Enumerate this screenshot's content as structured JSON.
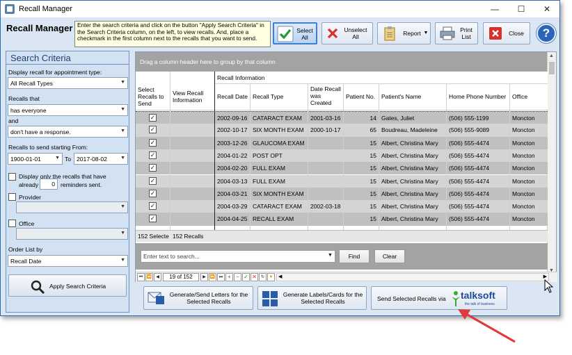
{
  "window": {
    "title": "Recall Manager",
    "controls": {
      "minimize": "—",
      "maximize": "☐",
      "close": "✕"
    }
  },
  "header": {
    "heading": "Recall Manager",
    "instructions": "Enter the search criteria and click on the button \"Apply Search Criteria\" in the Search Criteria column, on the left, to view recalls. And, place a checkmark in the first column next to the recalls that you want to send.",
    "buttons": {
      "select_all": "Select All",
      "unselect_all": "Unselect All",
      "report": "Report",
      "print_list": "Print List",
      "close": "Close",
      "help": "?"
    }
  },
  "search_criteria": {
    "title": "Search Criteria",
    "display_for_label": "Display recall for appointment type:",
    "display_for_value": "All Recall Types",
    "recalls_that_label": "Recalls that",
    "recalls_that_value": "has everyone",
    "and_label": "and",
    "response_value": "don't have a response.",
    "starting_from_label": "Recalls to send starting From:",
    "date_from": "1900-01-01",
    "to_label": "To",
    "date_to": "2017-08-02",
    "display_only_label_1": "Display only the recalls that have",
    "display_only_label_2a": "already",
    "reminders_count": "0",
    "display_only_label_2b": "reminders sent.",
    "provider_label": "Provider",
    "office_label": "Office",
    "order_label": "Order List by",
    "order_value": "Recall Date",
    "apply_button": "Apply Search Criteria"
  },
  "grid": {
    "group_hint": "Drag a column header here to group by that column",
    "band_label": "Recall Information",
    "columns": {
      "select": "Select Recalls to Send",
      "view": "View Recall Information",
      "recall_date": "Recall Date",
      "recall_type": "Recall Type",
      "date_created": "Date Recall was Created",
      "patient_no": "Patient No.",
      "patient_name": "Patient's Name",
      "phone": "Home Phone Number",
      "office": "Office"
    },
    "rows": [
      {
        "checked": "✓",
        "recall_date": "2002-09-16",
        "recall_type": "CATARACT EXAM",
        "date_created": "2001-03-16",
        "patient_no": "14",
        "patient_name": "Gates, Juliet",
        "phone": "(506) 555-1199",
        "office": "Moncton"
      },
      {
        "checked": "✓",
        "recall_date": "2002-10-17",
        "recall_type": "SIX MONTH EXAM",
        "date_created": "2000-10-17",
        "patient_no": "65",
        "patient_name": "Boudreau, Madeleine",
        "phone": "(506) 555-9089",
        "office": "Moncton"
      },
      {
        "checked": "✓",
        "recall_date": "2003-12-26",
        "recall_type": "GLAUCOMA EXAM",
        "date_created": "",
        "patient_no": "15",
        "patient_name": "Albert, Christina Mary",
        "phone": "(506) 555-4474",
        "office": "Moncton"
      },
      {
        "checked": "✓",
        "recall_date": "2004-01-22",
        "recall_type": "POST OPT",
        "date_created": "",
        "patient_no": "15",
        "patient_name": "Albert, Christina Mary",
        "phone": "(506) 555-4474",
        "office": "Moncton"
      },
      {
        "checked": "✓",
        "recall_date": "2004-02-20",
        "recall_type": "FULL EXAM",
        "date_created": "",
        "patient_no": "15",
        "patient_name": "Albert, Christina Mary",
        "phone": "(506) 555-4474",
        "office": "Moncton"
      },
      {
        "checked": "✓",
        "recall_date": "2004-03-13",
        "recall_type": "FULL EXAM",
        "date_created": "",
        "patient_no": "15",
        "patient_name": "Albert, Christina Mary",
        "phone": "(506) 555-4474",
        "office": "Moncton"
      },
      {
        "checked": "✓",
        "recall_date": "2004-03-21",
        "recall_type": "SIX MONTH EXAM",
        "date_created": "",
        "patient_no": "15",
        "patient_name": "Albert, Christina Mary",
        "phone": "(506) 555-4474",
        "office": "Moncton"
      },
      {
        "checked": "✓",
        "recall_date": "2004-03-29",
        "recall_type": "CATARACT EXAM",
        "date_created": "2002-03-18",
        "patient_no": "15",
        "patient_name": "Albert, Christina Mary",
        "phone": "(506) 555-4474",
        "office": "Moncton"
      },
      {
        "checked": "✓",
        "recall_date": "2004-04-25",
        "recall_type": "RECALL EXAM",
        "date_created": "",
        "patient_no": "15",
        "patient_name": "Albert, Christina Mary",
        "phone": "(506) 555-4474",
        "office": "Moncton"
      }
    ],
    "footer": {
      "selected": "152 Selecte",
      "recalls": "152 Recalls"
    },
    "search_placeholder": "Enter text to search...",
    "find_button": "Find",
    "clear_button": "Clear",
    "navigator": {
      "position": "19 of 152"
    }
  },
  "bottom_actions": {
    "letters": "Generate/Send Letters for the Selected Recalls",
    "labels": "Generate Labels/Cards for the Selected Recalls",
    "talksoft": "Send Selected Recalls via",
    "talksoft_logo": "talksoft",
    "talksoft_tagline": "the talk of business"
  },
  "colors": {
    "row_alt": "#c0c0c0",
    "row_base": "#d4d4d4",
    "accent": "#2b6ab4",
    "arrow": "#e0393e"
  }
}
